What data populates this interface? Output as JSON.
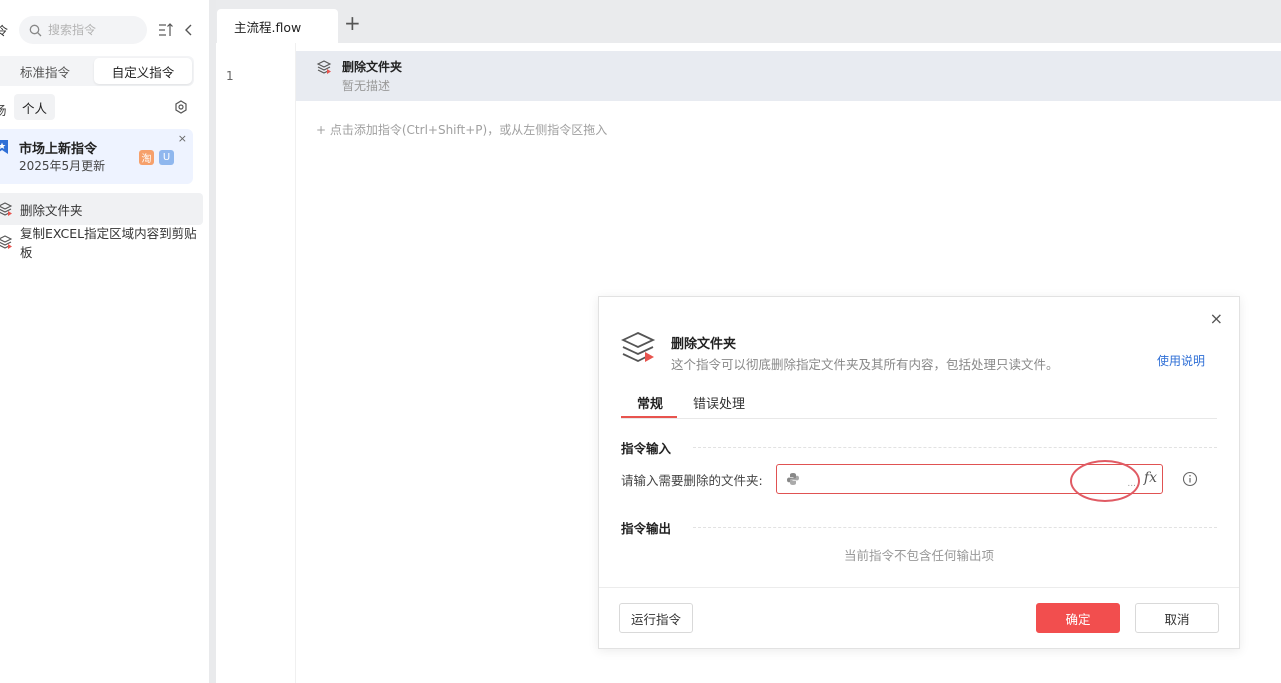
{
  "sidebar": {
    "cut_glyph": "令",
    "search_placeholder": "搜索指令",
    "segments": [
      "标准指令",
      "自定义指令"
    ],
    "scope_cut": "场",
    "scope_pill": "个人",
    "promo": {
      "title": "市场上新指令",
      "subtitle": "2025年5月更新",
      "close": "×",
      "badge_tao": "淘",
      "badge_u": "U"
    },
    "items": [
      {
        "label": "删除文件夹",
        "selected": true
      },
      {
        "label": "复制EXCEL指定区域内容到剪贴板",
        "selected": false
      }
    ]
  },
  "editor": {
    "tab_label": "主流程.flow",
    "add_tab": "+",
    "line_number": "1",
    "step": {
      "title": "删除文件夹",
      "desc": "暂无描述"
    },
    "add_hint": "+  点击添加指令(Ctrl+Shift+P)，或从左侧指令区拖入"
  },
  "dialog": {
    "close": "×",
    "title": "删除文件夹",
    "desc": "这个指令可以彻底删除指定文件夹及其所有内容，包括处理只读文件。",
    "help": "使用说明",
    "tabs": [
      "常规",
      "错误处理"
    ],
    "input_section": "指令输入",
    "field_label": "请输入需要删除的文件夹:",
    "field_value": "",
    "fx": "fx",
    "dots": "...",
    "output_section": "指令输出",
    "no_output": "当前指令不包含任何输出项",
    "run_button": "运行指令",
    "ok_button": "确定",
    "cancel_button": "取消"
  },
  "colors": {
    "accent_red": "#f24e4e",
    "link_blue": "#2f6fd6",
    "annotation": "#e05b64"
  }
}
